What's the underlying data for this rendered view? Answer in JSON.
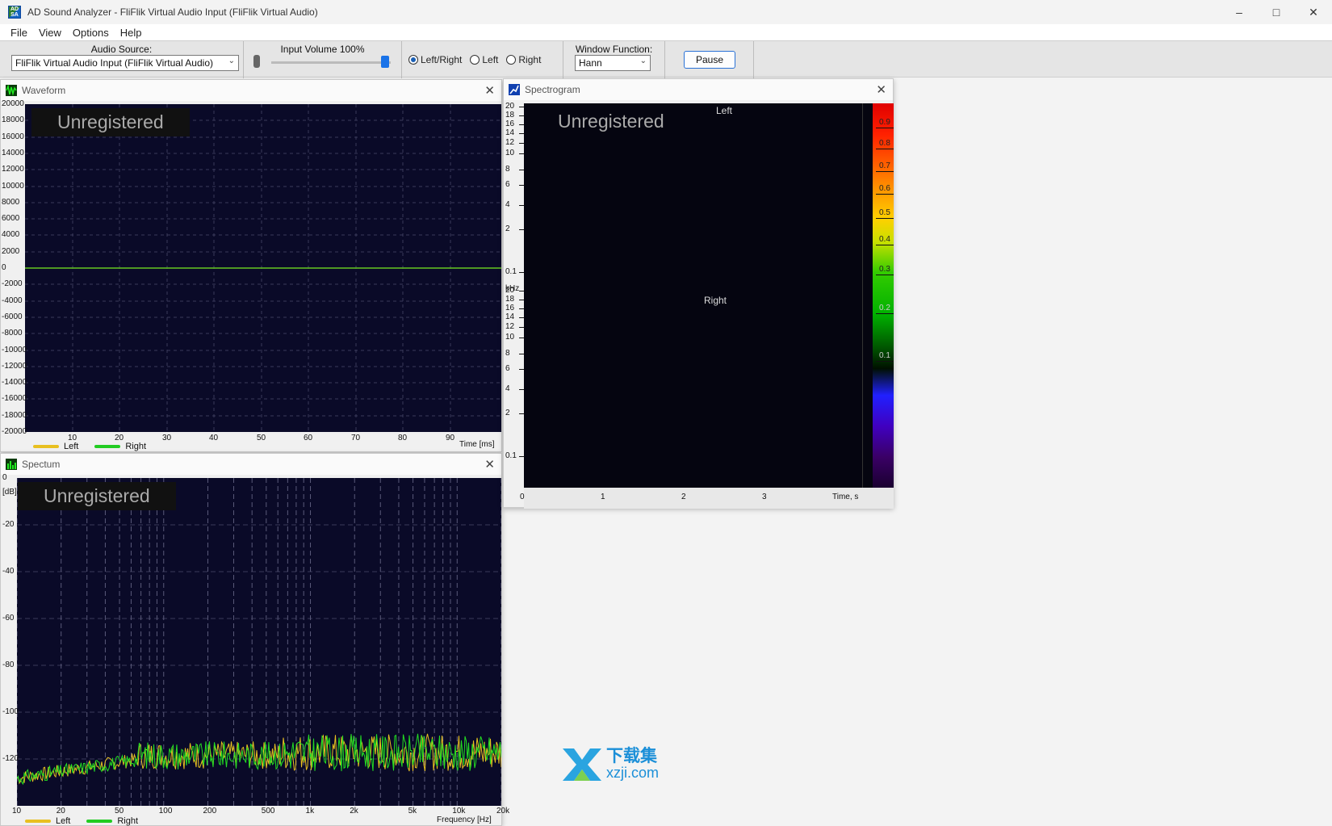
{
  "window": {
    "title": "AD Sound Analyzer - FliFlik Virtual Audio Input (FliFlik Virtual Audio)",
    "app_icon_label": "AD SA"
  },
  "menu": [
    "File",
    "View",
    "Options",
    "Help"
  ],
  "toolbar": {
    "audio_source_label": "Audio Source:",
    "audio_source_value": "FliFlik Virtual Audio Input (FliFlik Virtual Audio)",
    "input_volume_label": "Input Volume 100%",
    "input_volume_level": 1.0,
    "channels": [
      {
        "label": "Left/Right",
        "selected": true
      },
      {
        "label": "Left",
        "selected": false
      },
      {
        "label": "Right",
        "selected": false
      }
    ],
    "window_function_label": "Window Function:",
    "window_function_value": "Hann",
    "pause_label": "Pause"
  },
  "waveform": {
    "title": "Waveform",
    "watermark": "Unregistered",
    "y_ticks": [
      "20000",
      "18000",
      "16000",
      "14000",
      "12000",
      "10000",
      "8000",
      "6000",
      "4000",
      "2000",
      "0",
      "-2000",
      "-4000",
      "-6000",
      "-8000",
      "-10000",
      "-12000",
      "-14000",
      "-16000",
      "-18000",
      "-20000"
    ],
    "x_ticks": [
      "10",
      "20",
      "30",
      "40",
      "50",
      "60",
      "70",
      "80",
      "90"
    ],
    "x_axis_label": "Time [ms]",
    "legend": [
      {
        "name": "Left",
        "color": "#e8c020"
      },
      {
        "name": "Right",
        "color": "#22cc22"
      }
    ]
  },
  "spectrum": {
    "title": "Spectum",
    "watermark": "Unregistered",
    "y_ticks": [
      "0",
      "-20",
      "-40",
      "-60",
      "-80",
      "-100",
      "-120"
    ],
    "y_unit": "[dB]",
    "x_ticks": [
      "10",
      "20",
      "50",
      "100",
      "200",
      "500",
      "1k",
      "2k",
      "5k",
      "10k",
      "20k"
    ],
    "x_axis_label": "Frequency [Hz]",
    "legend": [
      {
        "name": "Left",
        "color": "#e8c020"
      },
      {
        "name": "Right",
        "color": "#22cc22"
      }
    ]
  },
  "spectrogram": {
    "title": "Spectrogram",
    "watermark": "Unregistered",
    "channel_top": "Left",
    "channel_bottom": "Right",
    "y_ticks_top": [
      "20",
      "18",
      "16",
      "14",
      "12",
      "10",
      "8",
      "6",
      "4",
      "2",
      "0.1"
    ],
    "y_ticks_bottom": [
      "20",
      "18",
      "16",
      "14",
      "12",
      "10",
      "8",
      "6",
      "4",
      "2",
      "0.1"
    ],
    "y_unit": "kHz",
    "x_ticks": [
      "0",
      "1",
      "2",
      "3"
    ],
    "x_axis_label": "Time, s",
    "colorbar_ticks": [
      "0.9",
      "0.8",
      "0.7",
      "0.6",
      "0.5",
      "0.4",
      "0.3",
      "0.2",
      "0.1"
    ]
  },
  "site_watermark": {
    "cn": "下载集",
    "url": "xzji.com"
  }
}
